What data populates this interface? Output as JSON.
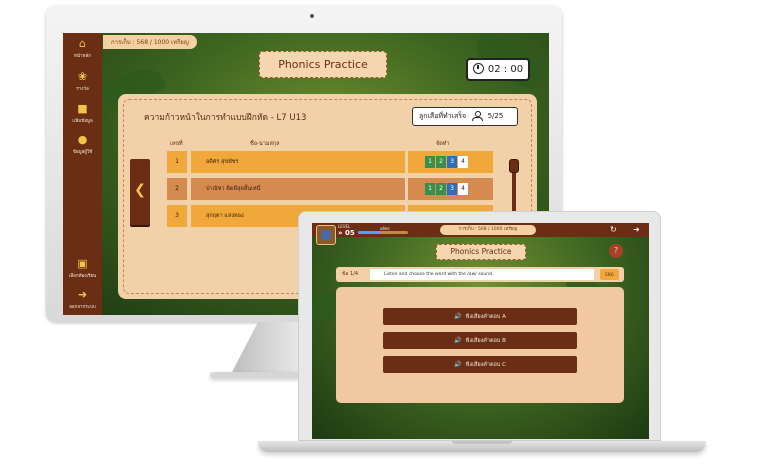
{
  "monitor": {
    "coin_text": "การเก็บ : 568 / 1000 เหรียญ",
    "title": "Phonics Practice",
    "timer": "02 : 00",
    "sidebar": [
      {
        "icon": "home-icon",
        "label": "หน้าหลัก"
      },
      {
        "icon": "reward-icon",
        "label": "รางวัล"
      },
      {
        "icon": "folder-icon",
        "label": "แฟ้มข้อมูล"
      },
      {
        "icon": "user-icon",
        "label": "ข้อมูลผู้ใช้"
      },
      {
        "icon": "board-icon",
        "label": "เลือกห้องเรียน"
      },
      {
        "icon": "logout-icon",
        "label": "ออกจากระบบ"
      }
    ],
    "panel": {
      "title": "ความก้าวหน้าในการทำแบบฝึกหัด - L7 U13",
      "done_label": "ลูกเสือที่ทำเสร็จ",
      "done_count": "5/25",
      "headers": {
        "no": "เลขที่",
        "name": "ชื่อ-นามสกุล",
        "level": "จัดทำ"
      },
      "rows": [
        {
          "no": "1",
          "name": "อดิศร สุขพัชร"
        },
        {
          "no": "2",
          "name": "ปาณิชา คิดดีสุดสิ้นเหนื่"
        },
        {
          "no": "3",
          "name": "สุกฤตา แสงทอง"
        }
      ],
      "levels": [
        "1",
        "2",
        "3",
        "4"
      ]
    }
  },
  "laptop": {
    "level_label": "LEVEL",
    "level_num": "» 05",
    "level_name": "อดิศร",
    "level_progress": 0.45,
    "coin_text": "การเก็บ : 568 / 1000 เหรียญ",
    "title": "Phonics Practice",
    "help": "?",
    "question_no": "ข้อ 1/4",
    "question_text": "Listen and choose the word with the /aw/ sound.",
    "lang": "ENG",
    "answers": [
      "ฟังเสียงคำตอบ A",
      "ฟังเสียงคำตอบ B",
      "ฟังเสียงคำตอบ C"
    ]
  },
  "colors": {
    "brown": "#6b2e14",
    "orange": "#f1a83a",
    "cream": "#f2d1a9"
  }
}
